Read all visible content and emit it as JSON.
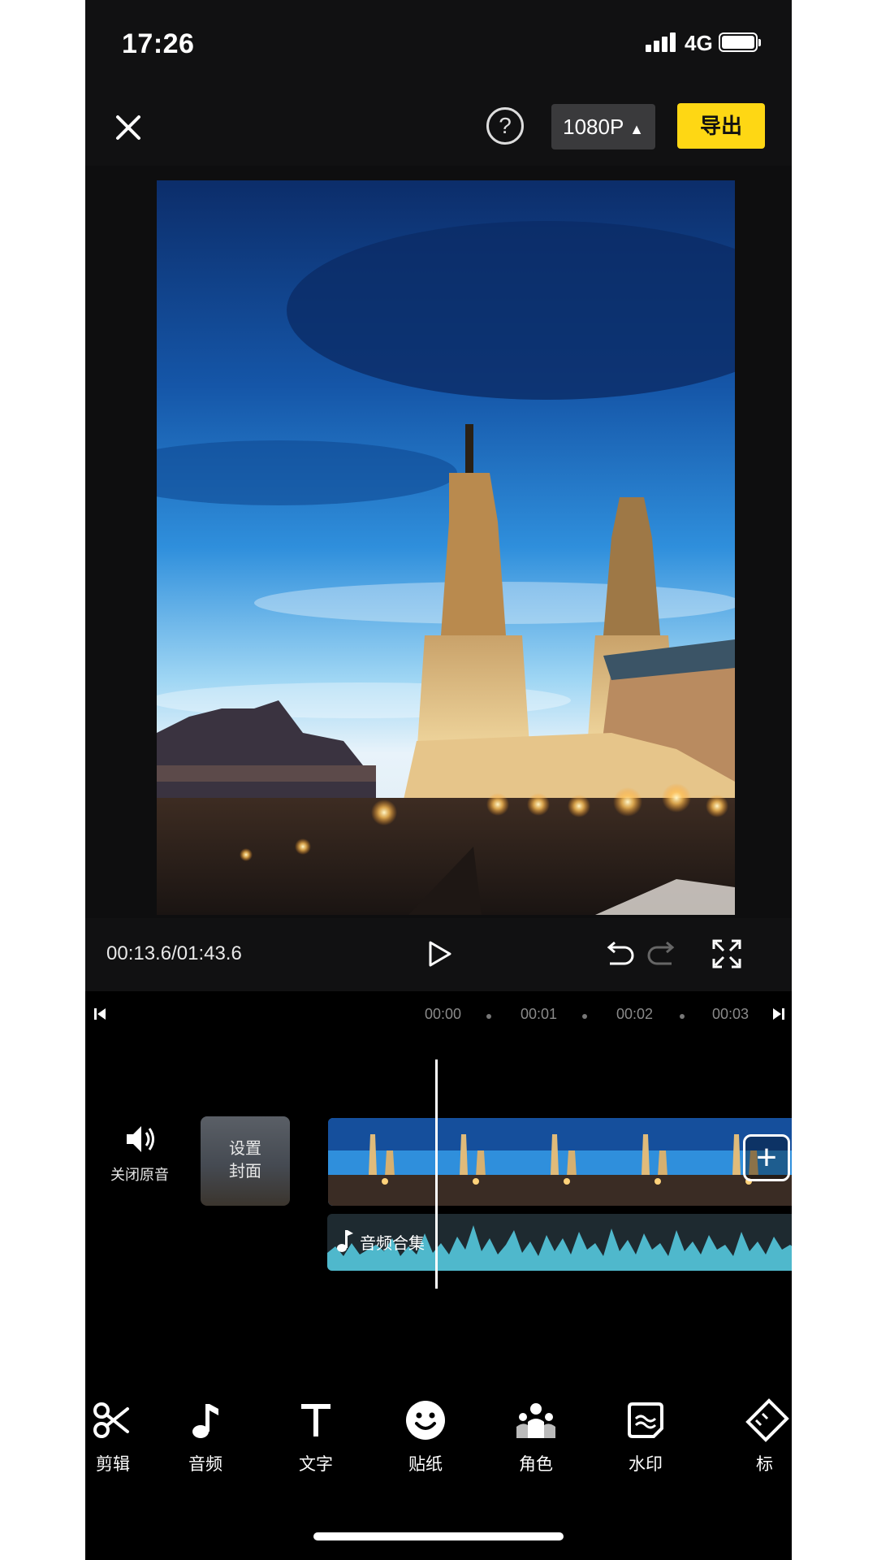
{
  "status_bar": {
    "time": "17:26",
    "network": "4G"
  },
  "top_bar": {
    "resolution_label": "1080P",
    "export_label": "导出"
  },
  "player": {
    "timecode": "00:13.6/01:43.6"
  },
  "timeline": {
    "ruler_ticks": [
      "00:00",
      "00:01",
      "00:02",
      "00:03"
    ],
    "mute_label": "关闭原音",
    "cover_label": "设置封面",
    "cover_label_lines": [
      "设置",
      "封面"
    ],
    "audio_track_label": "音频合集"
  },
  "toolbar": {
    "items": [
      {
        "label": "剪辑",
        "icon": "scissors-icon"
      },
      {
        "label": "音频",
        "icon": "music-note-icon"
      },
      {
        "label": "文字",
        "icon": "text-icon"
      },
      {
        "label": "贴纸",
        "icon": "sticker-smiley-icon"
      },
      {
        "label": "角色",
        "icon": "characters-icon"
      },
      {
        "label": "水印",
        "icon": "watermark-icon"
      },
      {
        "label": "标",
        "icon": "ruler-icon"
      }
    ]
  },
  "colors": {
    "accent": "#fed714",
    "background": "#0e0e0f",
    "waveform": "#4fb8cc"
  }
}
